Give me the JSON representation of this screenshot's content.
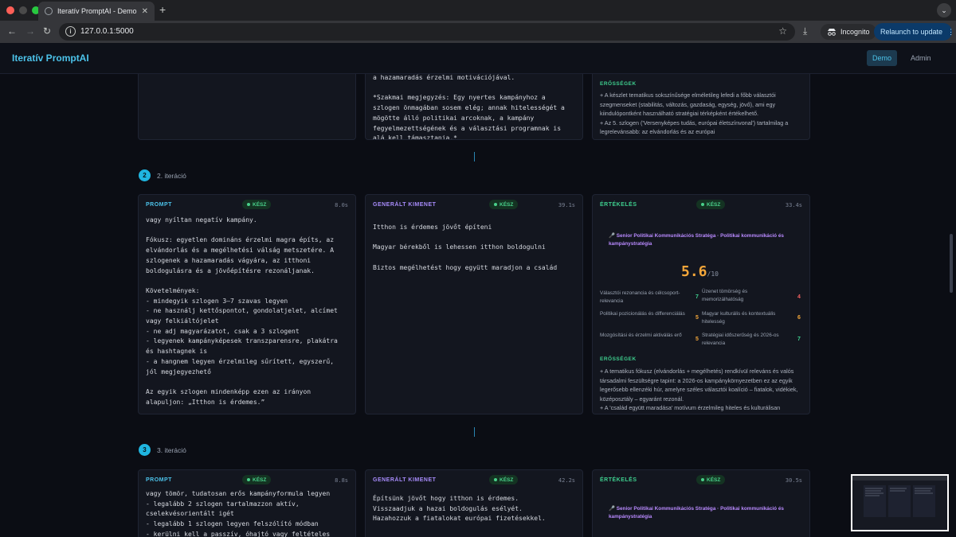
{
  "browser": {
    "tab_title": "Iteratív PromptAI - Demo",
    "url": "127.0.0.1:5000",
    "incognito_label": "Incognito",
    "relaunch_label": "Relaunch to update"
  },
  "app": {
    "brand": "Iteratív PromptAI",
    "nav": {
      "demo": "Demo",
      "admin": "Admin"
    }
  },
  "labels": {
    "prompt": "PROMPT",
    "output": "GENERÁLT KIMENET",
    "evaluation": "ÉRTÉKELÉS",
    "status_done": "KÉSZ",
    "strengths": "ERŐSSÉGEK"
  },
  "iteration1_tail": {
    "output_text": "a hazamaradás érzelmi motivációjával.\n\n*Szakmai megjegyzés: Egy nyertes kampányhoz a szlogen önmagában sosem elég; annak hitelességét a mögötte álló politikai arcoknak, a kampány fegyelmezettségének és a választási programnak is alá kell támasztania.*",
    "eval_text": "+ A készlet tematikus sokszínűsége elméletileg lefedi a főbb választói szegmenseket (stabilitás, változás, gazdaság, egység, jövő), ami egy kiindulópontként használható stratégiai térképként értékelhető.\n+ Az 5. szlogen ('Versenyképes tudás, európai életszínvonal') tartalmilag a legrelevánsabb: az elvándorlás és az európai"
  },
  "iteration2": {
    "number": "2",
    "label": "2. iteráció",
    "prompt_time": "8.0s",
    "output_time": "39.1s",
    "eval_time": "33.4s",
    "prompt_text": "vagy nyíltan negatív kampány.\n\nFókusz: egyetlen domináns érzelmi magra építs, az elvándorlás és a megélhetési válság metszetére. A szlogenek a hazamaradás vágyára, az itthoni boldogulásra és a jövőépítésre rezonáljanak.\n\nKövetelmények:\n- mindegyik szlogen 3–7 szavas legyen\n- ne használj kettőspontot, gondolatjelet, alcímet vagy felkiáltójelet\n- ne adj magyarázatot, csak a 3 szlogent\n- legyenek kampányképesek transzparensre, plakátra és hashtagnek is\n- a hangnem legyen érzelmileg sűrített, egyszerű, jól megjegyezhető\n\nAz egyik szlogen mindenképp ezen az irányon alapuljon: „Itthon is érdemes.”",
    "output_text": "Itthon is érdemes jövőt építeni\n\nMagyar bérekből is lehessen itthon boldogulni\n\nBiztos megélhetést hogy együtt maradjon a család",
    "persona": "🎤 Senior Politikai Kommunikációs Stratéga · Politikai kommunikáció és kampánystratégia",
    "score": "5.6",
    "score_den": "/10",
    "criteria": [
      {
        "name": "Választói rezonancia és célcsoport-relevancia",
        "score": "7"
      },
      {
        "name": "Üzenet tömörség és memorizálhatóság",
        "score": "4"
      },
      {
        "name": "Politikai pozicionálás és differenciálás",
        "score": "5"
      },
      {
        "name": "Magyar kulturális és kontextuális hitelesség",
        "score": "6"
      },
      {
        "name": "Mozgósítási és érzelmi aktiválás erő",
        "score": "5"
      },
      {
        "name": "Stratégiai időszerűség és 2026-os relevancia",
        "score": "7"
      }
    ],
    "strengths_text": "+ A tematikus fókusz (elvándorlás + megélhetés) rendkívül releváns és valós társadalmi feszültségre tapint: a 2026-os kampánykörnyezetben ez az egyik legerősebb ellenzéki húr, amelyre széles választói koalíció – fiatalok, vidékiek, középosztály – egyaránt rezonál.\n+ A 'család együtt maradása' motívum érzelmileg hiteles és kulturálisan"
  },
  "iteration3": {
    "number": "3",
    "label": "3. iteráció",
    "prompt_time": "8.8s",
    "output_time": "42.2s",
    "eval_time": "30.5s",
    "prompt_text": "vagy tömör, tudatosan erős kampányformula legyen\n- legalább 2 szlogen tartalmazzon aktív, cselekvésorientált igét\n- legalább 1 szlogen legyen felszólító módban\n- kerülni kell a passzív, óhajtó vagy feltételes",
    "output_text": "Építsünk jövőt hogy itthon is érdemes.\nVisszaadjuk a hazai boldogulás esélyét.\nHazahozzuk a fiatalokat európai fizetésekkel.",
    "persona": "🎤 Senior Politikai Kommunikációs Stratéga · Politikai kommunikáció és kampánystratégia"
  },
  "colors": {
    "accent": "#4cc3ea",
    "done": "#49d08a",
    "output_label": "#a78bfa",
    "eval_label": "#3ecf8e",
    "score": "#f3a63a"
  }
}
